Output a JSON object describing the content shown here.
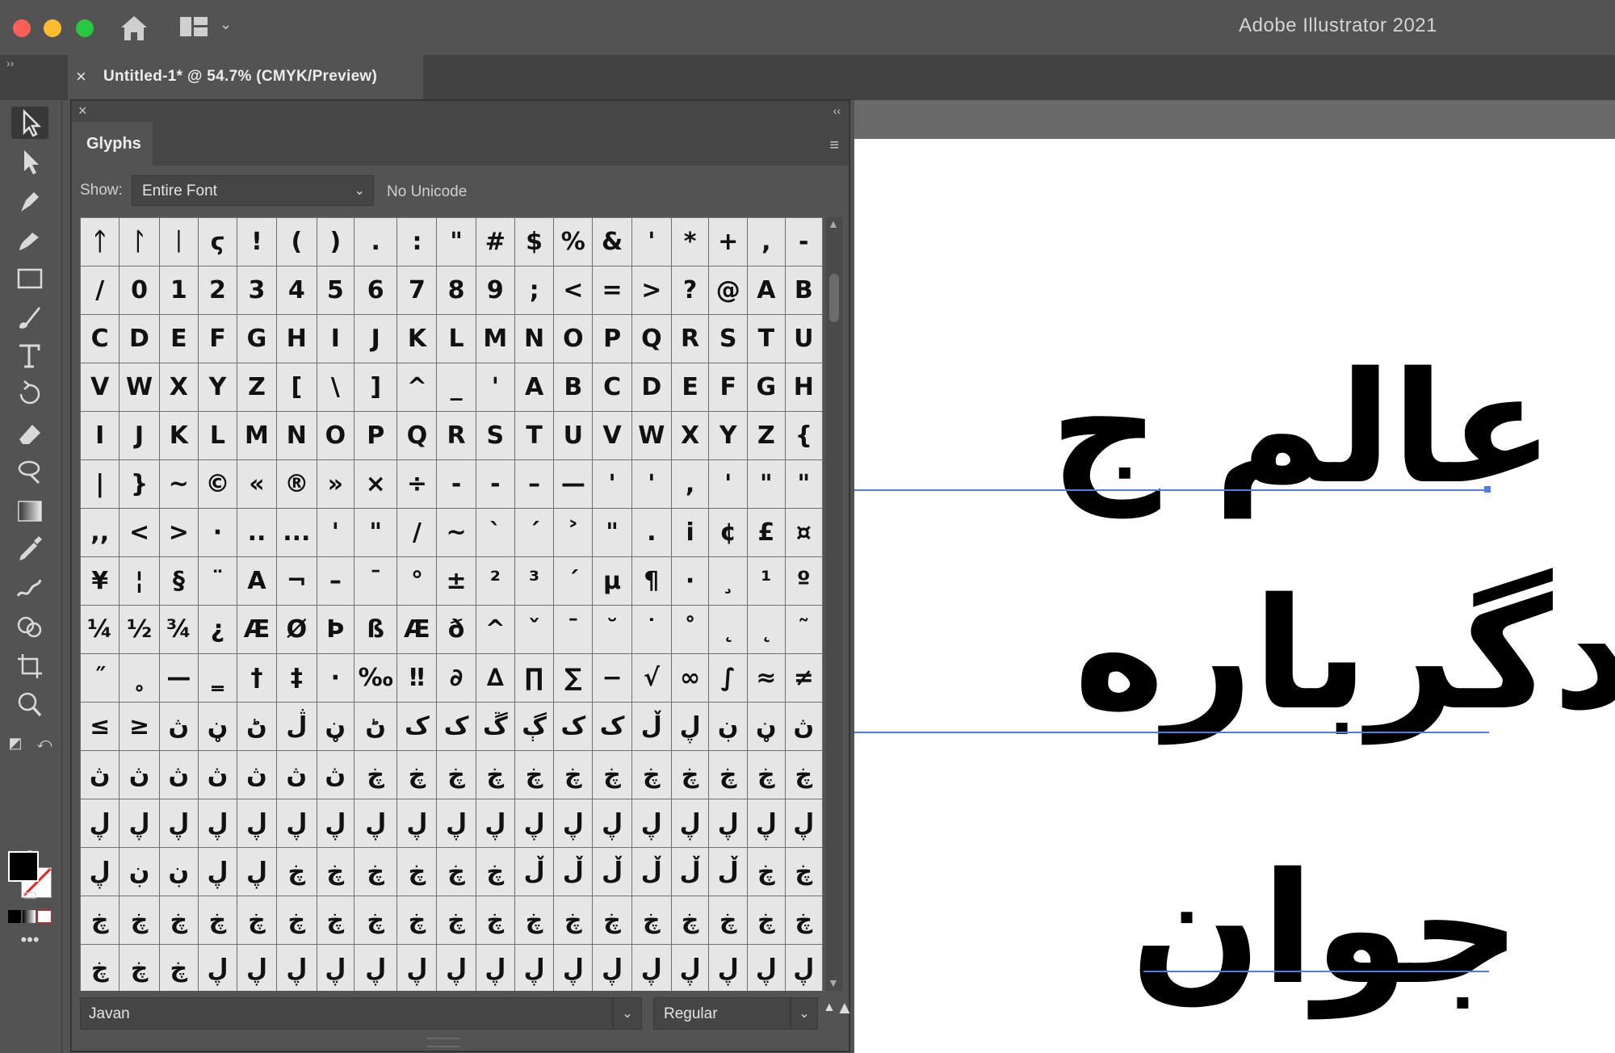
{
  "app": {
    "title": "Adobe Illustrator 2021"
  },
  "document_tab": {
    "close": "×",
    "title": "Untitled-1* @ 54.7% (CMYK/Preview)"
  },
  "toolbar_collapse": "››",
  "glyphs_panel": {
    "close": "×",
    "collapse": "‹‹",
    "tab_label": "Glyphs",
    "menu": "≡",
    "show_label": "Show:",
    "show_value": "Entire Font",
    "unicode_label": "No Unicode",
    "font_family": "Javan",
    "font_style": "Regular",
    "glyph_rows": [
      [
        "ᛏ",
        "ᛚ",
        "ᛁ",
        "ϛ",
        "!",
        "(",
        ")",
        ".",
        ":",
        "\"",
        "#",
        "$",
        "%",
        "&",
        "'",
        "*",
        "+",
        ",",
        "-"
      ],
      [
        "/",
        "0",
        "1",
        "2",
        "3",
        "4",
        "5",
        "6",
        "7",
        "8",
        "9",
        ";",
        "<",
        "=",
        ">",
        "?",
        "@",
        "A",
        "B"
      ],
      [
        "C",
        "D",
        "E",
        "F",
        "G",
        "H",
        "I",
        "J",
        "K",
        "L",
        "M",
        "N",
        "O",
        "P",
        "Q",
        "R",
        "S",
        "T",
        "U"
      ],
      [
        "V",
        "W",
        "X",
        "Y",
        "Z",
        "[",
        "\\",
        "]",
        "^",
        "_",
        "'",
        "A",
        "B",
        "C",
        "D",
        "E",
        "F",
        "G",
        "H"
      ],
      [
        "I",
        "J",
        "K",
        "L",
        "M",
        "N",
        "O",
        "P",
        "Q",
        "R",
        "S",
        "T",
        "U",
        "V",
        "W",
        "X",
        "Y",
        "Z",
        "{"
      ],
      [
        "|",
        "}",
        "~",
        "©",
        "«",
        "®",
        "»",
        "×",
        "÷",
        "-",
        "-",
        "–",
        "—",
        "'",
        "'",
        ",",
        "'",
        "\"",
        "\""
      ],
      [
        ",,",
        "<",
        ">",
        "·",
        "..",
        "...",
        "'",
        "\"",
        "/",
        "~",
        "`",
        "´",
        "˃",
        "\"",
        ".",
        "i",
        "¢",
        "£",
        "¤"
      ],
      [
        "¥",
        "¦",
        "§",
        "¨",
        "A",
        "¬",
        "–",
        "¯",
        "°",
        "±",
        "²",
        "³",
        "´",
        "µ",
        "¶",
        "·",
        "¸",
        "¹",
        "º"
      ],
      [
        "¼",
        "½",
        "¾",
        "¿",
        "Æ",
        "Ø",
        "Þ",
        "ß",
        "Æ",
        "ð",
        "^",
        "ˇ",
        "¯",
        "˘",
        "˙",
        "˚",
        "˛",
        "˛",
        "˜"
      ],
      [
        "˝",
        "˳",
        "—",
        "‗",
        "†",
        "‡",
        "·",
        "‰",
        "‼",
        "∂",
        "∆",
        "∏",
        "∑",
        "−",
        "√",
        "∞",
        "∫",
        "≈",
        "≠"
      ],
      [
        "≤",
        "≥",
        "ڽ",
        "ڼ",
        "ڻ",
        "ڷ",
        "ڼ",
        "ڻ",
        "ک",
        "ک",
        "ڱ",
        "ڳ",
        "ک",
        "ک",
        "ڵ",
        "ڸ",
        "ڹ",
        "ڼ",
        "ڽ"
      ],
      [
        "ڽ",
        "ڽ",
        "ڽ",
        "ڽ",
        "ڽ",
        "ڽ",
        "ڽ",
        "ڿ",
        "ڿ",
        "ڿ",
        "ڿ",
        "ڿ",
        "ڿ",
        "ڿ",
        "ڿ",
        "ڿ",
        "ڿ",
        "ڿ",
        "ڿ"
      ],
      [
        "ڸ",
        "ڸ",
        "ڸ",
        "ڸ",
        "ڸ",
        "ڸ",
        "ڸ",
        "ڸ",
        "ڸ",
        "ڸ",
        "ڸ",
        "ڸ",
        "ڸ",
        "ڸ",
        "ڸ",
        "ڸ",
        "ڸ",
        "ڸ",
        "ڸ"
      ],
      [
        "ڸ",
        "ڹ",
        "ڹ",
        "ڸ",
        "ڸ",
        "ڿ",
        "ڿ",
        "ڿ",
        "ڿ",
        "ڿ",
        "ڿ",
        "ڵ",
        "ڵ",
        "ڵ",
        "ڵ",
        "ڵ",
        "ڵ",
        "ڿ",
        "ڿ"
      ],
      [
        "ڿ",
        "ڿ",
        "ڿ",
        "ڿ",
        "ڿ",
        "ڿ",
        "ڿ",
        "ڿ",
        "ڿ",
        "ڿ",
        "ڿ",
        "ڿ",
        "ڿ",
        "ڿ",
        "ڿ",
        "ڿ",
        "ڿ",
        "ڿ",
        "ڿ"
      ],
      [
        "ڿ",
        "ڿ",
        "ڿ",
        "ڸ",
        "ڸ",
        "ڸ",
        "ڸ",
        "ڸ",
        "ڸ",
        "ڸ",
        "ڸ",
        "ڸ",
        "ڸ",
        "ڸ",
        "ڸ",
        "ڸ",
        "ڸ",
        "ڸ",
        "ڸ"
      ]
    ]
  },
  "artboard_text": [
    "عالم ج",
    "دگرباره",
    "جوان"
  ],
  "colors": {
    "ui_bg": "#535353",
    "panel_dark": "#474747",
    "glyph_cell": "#e6e6e6",
    "baseline": "#4f7de2",
    "close_red": "#fe5f57",
    "min_yellow": "#febc2e",
    "max_green": "#28c840"
  },
  "icons": [
    "home-icon",
    "workspace-switcher-icon",
    "selection-tool-icon",
    "direct-selection-tool-icon",
    "pen-tool-icon",
    "curvature-tool-icon",
    "rectangle-tool-icon",
    "paintbrush-tool-icon",
    "type-tool-icon",
    "rotate-tool-icon",
    "eraser-tool-icon",
    "lasso-tool-icon",
    "gradient-tool-icon",
    "eyedropper-tool-icon",
    "blend-tool-icon",
    "shape-builder-icon",
    "artboard-tool-icon",
    "zoom-tool-icon"
  ]
}
